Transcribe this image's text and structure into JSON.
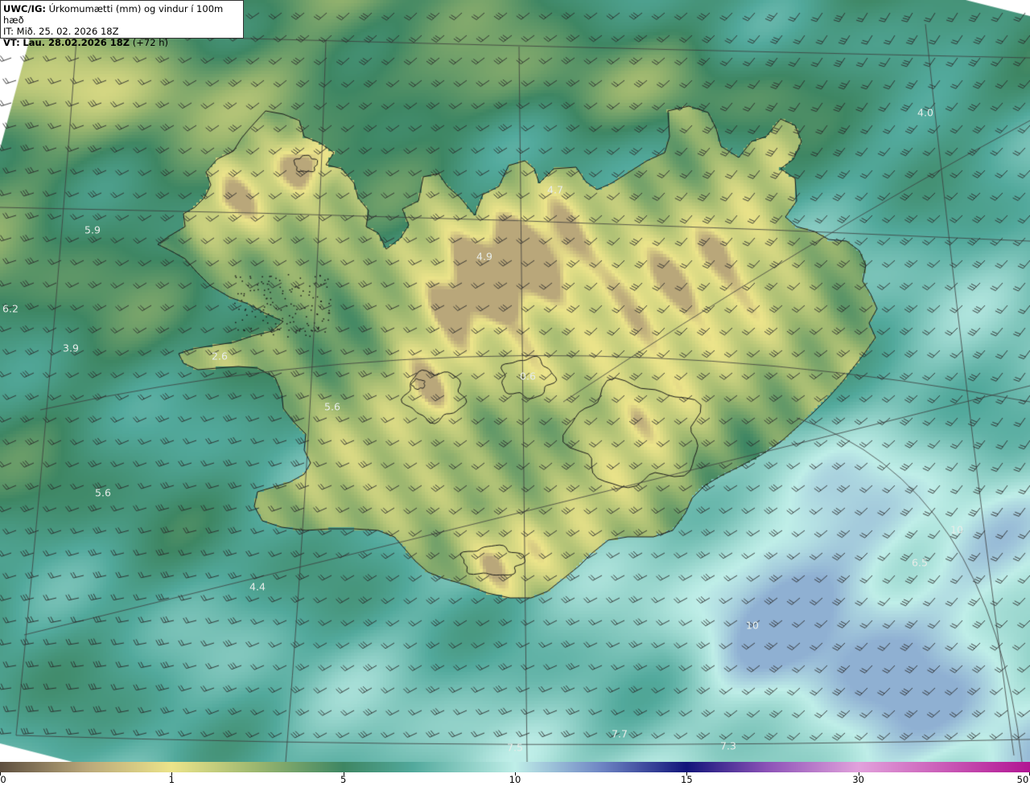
{
  "header": {
    "model": "UWC/IG:",
    "product": "Úrkomumætti (mm) og vindur í 100m hæð",
    "init_time": "IT: Mið. 25. 02. 2026 18Z",
    "valid_prefix": "VT:",
    "valid_time": "Lau. 28.02.2026 18Z",
    "lead_time": "(+72 h)"
  },
  "value_labels": [
    {
      "text": "4.0",
      "lon": 1150,
      "lat": 140
    },
    {
      "text": "4.7",
      "lon": 690,
      "lat": 236
    },
    {
      "text": "5.9",
      "lon": 115,
      "lat": 286
    },
    {
      "text": "4.9",
      "lon": 602,
      "lat": 319
    },
    {
      "text": "6.2",
      "lon": 13,
      "lat": 384
    },
    {
      "text": "3.9",
      "lon": 88,
      "lat": 433
    },
    {
      "text": "2.6",
      "lon": 273,
      "lat": 443
    },
    {
      "text": "0.6",
      "lon": 656,
      "lat": 468
    },
    {
      "text": "5.6",
      "lon": 413,
      "lat": 506
    },
    {
      "text": "5.6",
      "lon": 128,
      "lat": 613
    },
    {
      "text": "6.5",
      "lon": 1143,
      "lat": 700
    },
    {
      "text": "4.4",
      "lon": 320,
      "lat": 730
    },
    {
      "text": "10",
      "lon": 1189,
      "lat": 659
    },
    {
      "text": "10",
      "lon": 935,
      "lat": 778
    },
    {
      "text": "7.7",
      "lon": 770,
      "lat": 913
    },
    {
      "text": "7.3",
      "lon": 905,
      "lat": 928
    },
    {
      "text": "7.5",
      "lon": 640,
      "lat": 930
    }
  ],
  "colorbar": {
    "ticks": [
      {
        "value": 0,
        "label": "0"
      },
      {
        "value": 1,
        "label": "1"
      },
      {
        "value": 5,
        "label": "5"
      },
      {
        "value": 10,
        "label": "10"
      },
      {
        "value": 15,
        "label": "15"
      },
      {
        "value": 30,
        "label": "30"
      },
      {
        "value": 50,
        "label": "50"
      }
    ],
    "stops": [
      {
        "value": 0,
        "color": "#5e4f3f"
      },
      {
        "value": 0.5,
        "color": "#b9a77a"
      },
      {
        "value": 1,
        "color": "#ece48a"
      },
      {
        "value": 3,
        "color": "#9bb66f"
      },
      {
        "value": 5,
        "color": "#3e8663"
      },
      {
        "value": 7,
        "color": "#52a99c"
      },
      {
        "value": 10,
        "color": "#bfeee8"
      },
      {
        "value": 12.5,
        "color": "#6f86c4"
      },
      {
        "value": 15,
        "color": "#12157a"
      },
      {
        "value": 22,
        "color": "#8c52b7"
      },
      {
        "value": 30,
        "color": "#e2a2dc"
      },
      {
        "value": 50,
        "color": "#b11592"
      }
    ]
  },
  "colors": {
    "ocean_low": "#3b6b52",
    "ocean_mid": "#2f7d6a",
    "ocean_high": "#7bc9be",
    "land_low": "#6d8f59",
    "land_high": "#e6df8c",
    "coast": "#1a1a1a",
    "grid": "#3c3c3c",
    "barb": "#2a2a2a"
  }
}
